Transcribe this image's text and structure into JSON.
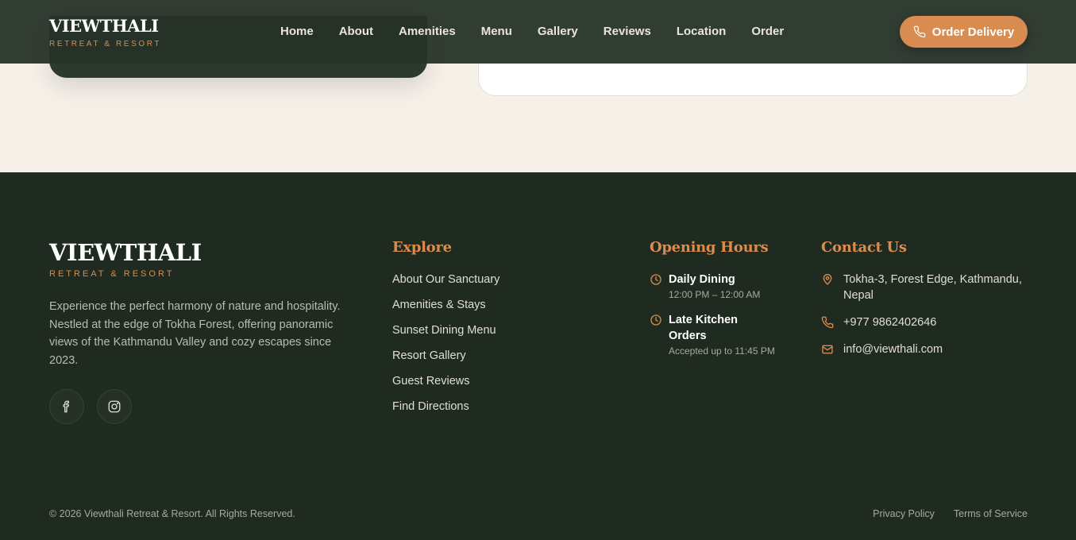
{
  "header": {
    "brand_name": "VIEWTHALI",
    "brand_tagline": "RETREAT & RESORT",
    "nav": [
      "Home",
      "About",
      "Amenities",
      "Menu",
      "Gallery",
      "Reviews",
      "Location",
      "Order"
    ],
    "cta_label": "Order Delivery",
    "cta_icon": "phone-icon"
  },
  "footer": {
    "brand_name": "VIEWTHALI",
    "brand_tagline": "RETREAT & RESORT",
    "description": "Experience the perfect harmony of nature and hospitality. Nestled at the edge of Tokha Forest, offering panoramic views of the Kathmandu Valley and cozy escapes since 2023.",
    "socials": [
      {
        "name": "facebook-icon"
      },
      {
        "name": "instagram-icon"
      }
    ],
    "explore": {
      "title": "Explore",
      "links": [
        "About Our Sanctuary",
        "Amenities & Stays",
        "Sunset Dining Menu",
        "Resort Gallery",
        "Guest Reviews",
        "Find Directions"
      ]
    },
    "hours": {
      "title": "Opening Hours",
      "items": [
        {
          "title": "Daily Dining",
          "detail": "12:00 PM – 12:00 AM"
        },
        {
          "title": "Late Kitchen Orders",
          "detail": "Accepted up to 11:45 PM"
        }
      ]
    },
    "contact": {
      "title": "Contact Us",
      "address": "Tokha-3, Forest Edge, Kathmandu, Nepal",
      "phone": "+977 9862402646",
      "email": "info@viewthali.com"
    },
    "copyright": "© 2026 Viewthali Retreat & Resort. All Rights Reserved.",
    "legal": [
      "Privacy Policy",
      "Terms of Service"
    ]
  },
  "colors": {
    "accent": "#d98c4f",
    "footer_bg": "#1f2b21",
    "header_bg": "#263228",
    "page_bg": "#f5f0e8"
  }
}
